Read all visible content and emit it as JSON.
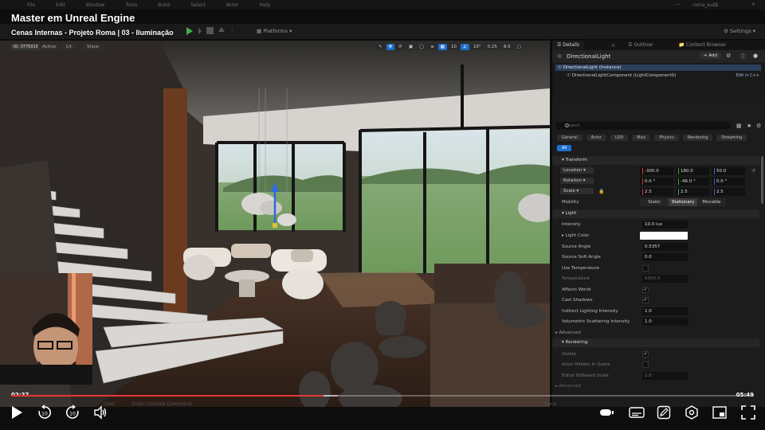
{
  "menubar": {
    "items": [
      "File",
      "Edit",
      "Window",
      "Tools",
      "Build",
      "Select",
      "Actor",
      "Help"
    ],
    "project": "roma_eula"
  },
  "video": {
    "course_title": "Master em Unreal Engine",
    "lesson_title": "Cenas Internas - Projeto Roma | 03 - Iluminação",
    "current_time": "02:27",
    "total_time": "05:49",
    "progress_fraction": 0.421,
    "buffered_fraction": 0.44
  },
  "toolbar": {
    "platforms_label": "Platforms",
    "settings_label": "Settings"
  },
  "viewport": {
    "id_badge": "ID: 3775015",
    "pills": [
      "Active",
      "Lit",
      "Show"
    ],
    "tools": [
      "10",
      "10°",
      "0.25",
      "8.5"
    ]
  },
  "panel": {
    "tabs": [
      "Details",
      "Outliner",
      "Content Browser"
    ],
    "actor_name": "DirectionalLight",
    "add_label": "Add",
    "instance_label": "DirectionalLight (Instance)",
    "component_label": "DirectionalLightComponent (LightComponent0)",
    "edit_cpp": "Edit in C++",
    "search_placeholder": "Search",
    "categories": [
      "General",
      "Actor",
      "LOD",
      "Misc",
      "Physics",
      "Rendering",
      "Streaming"
    ],
    "all_label": "All",
    "transform": {
      "title": "Transform",
      "location_label": "Location",
      "location": [
        "-300.0",
        "180.0",
        "50.0"
      ],
      "rotation_label": "Rotation",
      "rotation": [
        "0.0 °",
        "-46.0 °",
        "0.0 °"
      ],
      "scale_label": "Scale",
      "scale": [
        "2.5",
        "2.5",
        "2.5"
      ],
      "mobility_label": "Mobility",
      "mobility_options": [
        "Static",
        "Stationary",
        "Movable"
      ],
      "mobility_selected": "Stationary"
    },
    "light": {
      "title": "Light",
      "intensity_label": "Intensity",
      "intensity": "10.0 lux",
      "color_label": "Light Color",
      "source_angle_label": "Source Angle",
      "source_angle": "0.5357",
      "soft_angle_label": "Source Soft Angle",
      "soft_angle": "0.0",
      "use_temp_label": "Use Temperature",
      "temperature_label": "Temperature",
      "temperature": "6500.0",
      "affects_world_label": "Affects World",
      "cast_shadows_label": "Cast Shadows",
      "indirect_label": "Indirect Lighting Intensity",
      "indirect": "1.0",
      "volumetric_label": "Volumetric Scattering Intensity",
      "volumetric": "1.0",
      "advanced_label": "Advanced"
    },
    "rendering": {
      "title": "Rendering",
      "visible_label": "Visible",
      "hidden_label": "Actor Hidden In Game",
      "billboard_label": "Editor Billboard Scale",
      "billboard": "1.0",
      "advanced_label": "Advanced"
    }
  },
  "statusbar": {
    "cmd_label": "Cmd",
    "console_placeholder": "Enter Console Command",
    "trace_label": "Trace"
  },
  "colors": {
    "accent": "#1e6fd0",
    "progress": "#e53935",
    "play": "#3fae4a"
  }
}
